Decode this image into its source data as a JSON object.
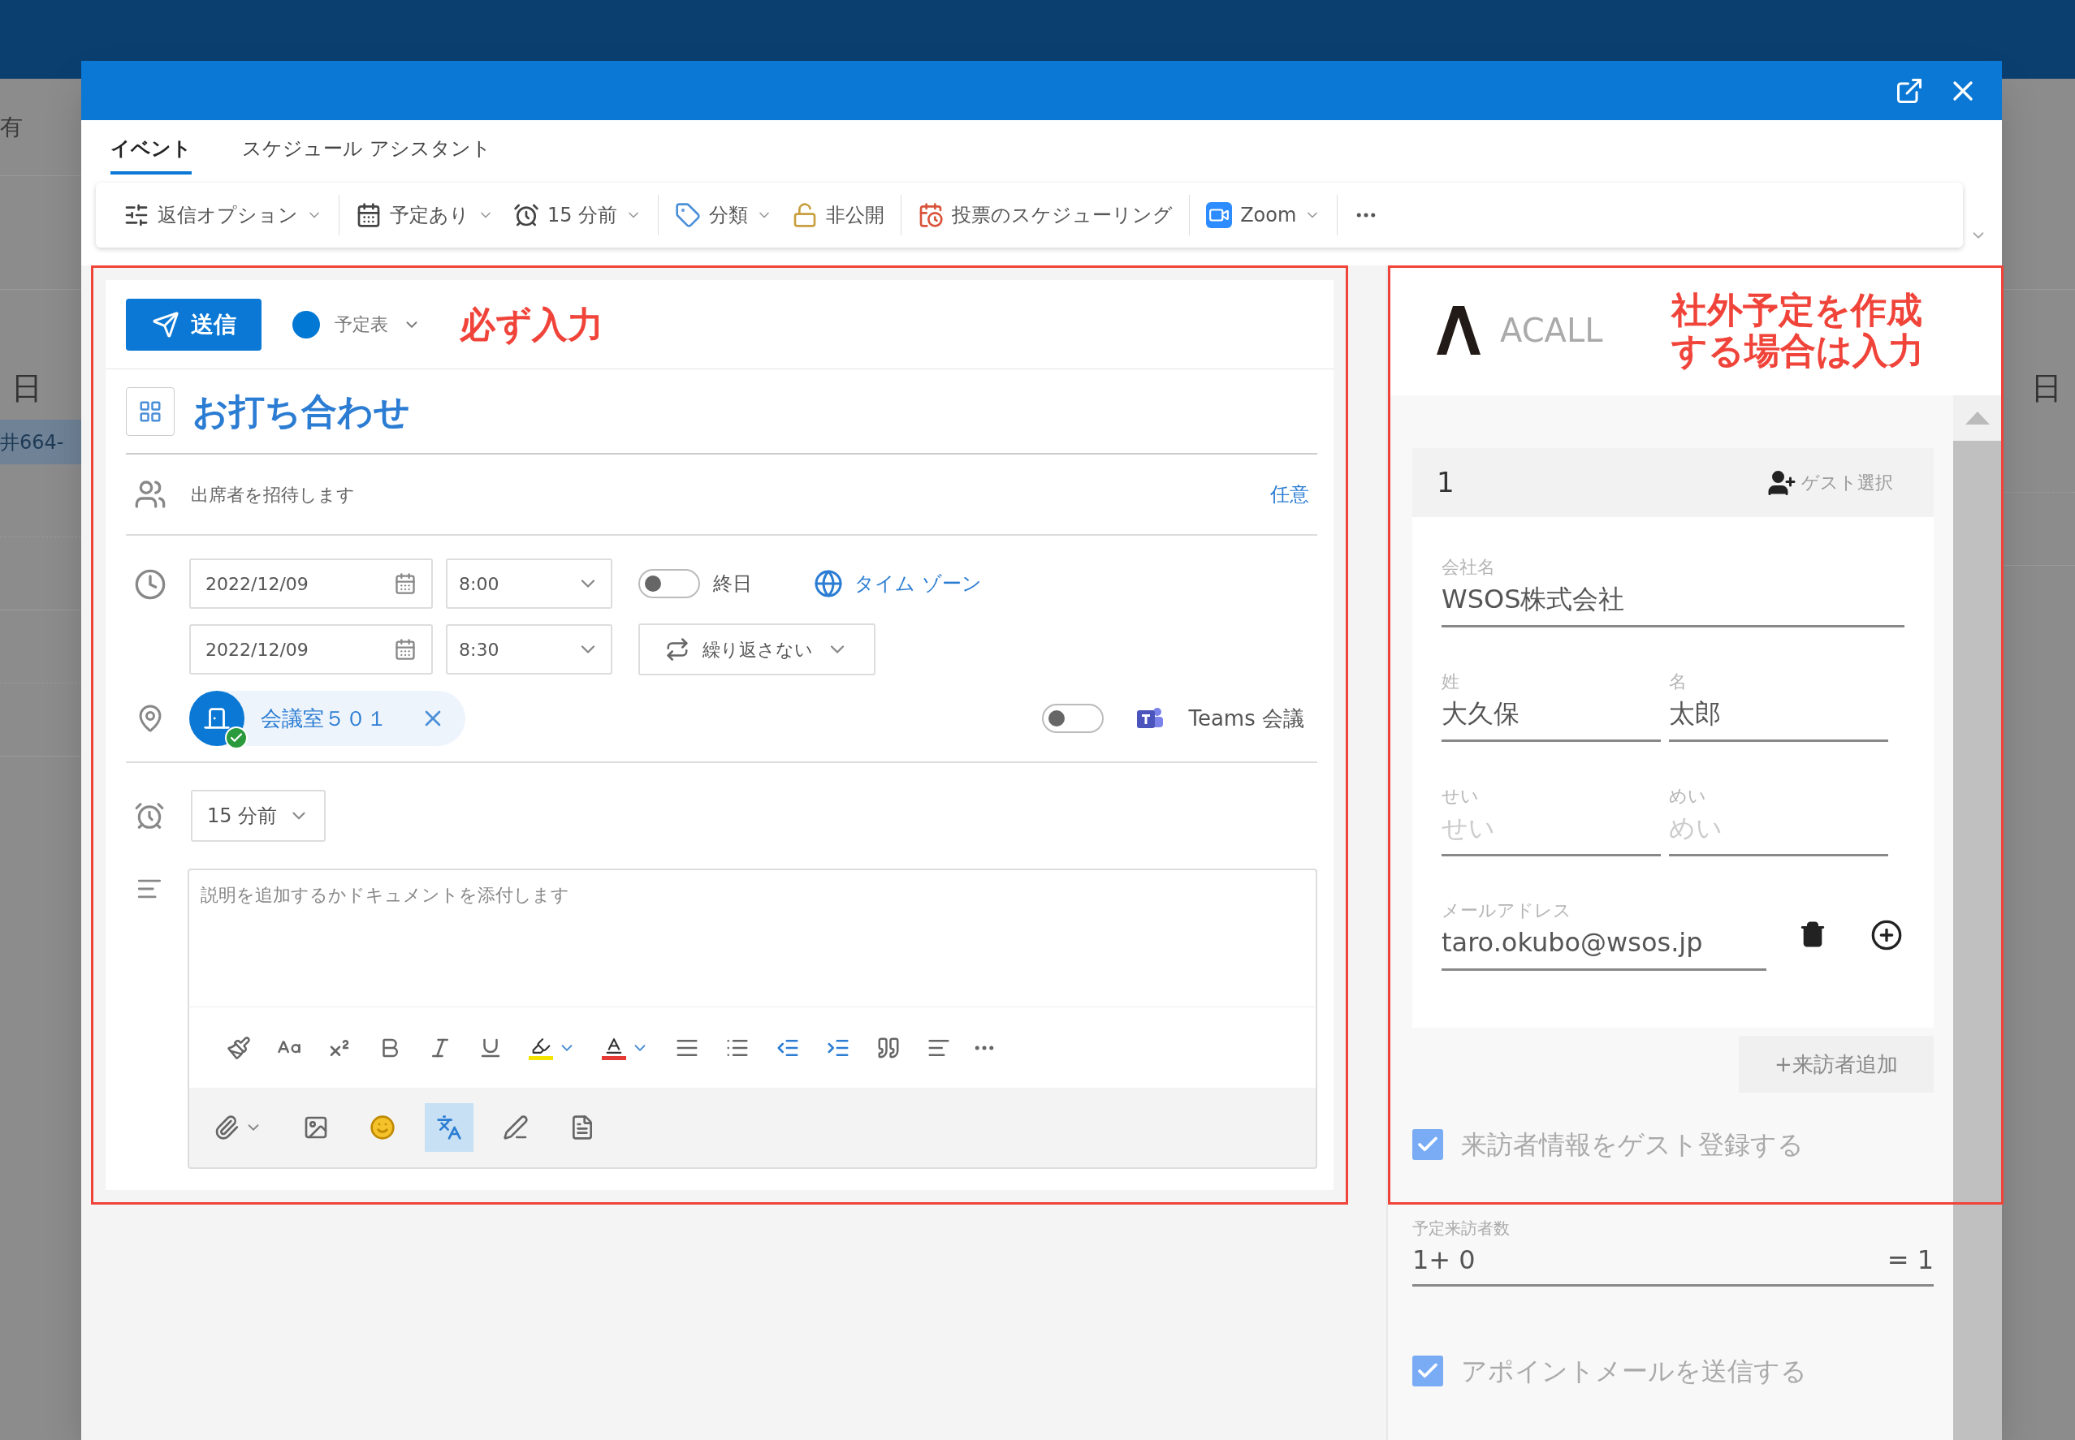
{
  "background": {
    "left_texts": [
      "有",
      "日",
      "井664-"
    ],
    "right_text": "日"
  },
  "tabs": [
    {
      "label": "イベント",
      "selected": true
    },
    {
      "label": "スケジュール アシスタント",
      "selected": false
    }
  ],
  "toolbar": [
    [
      {
        "label": "返信オプション",
        "dropdown": true
      }
    ],
    [
      {
        "label": "予定あり",
        "dropdown": true
      },
      {
        "label": "15 分前",
        "dropdown": true
      }
    ],
    [
      {
        "label": "分類",
        "dropdown": true
      },
      {
        "label": "非公開",
        "dropdown": false
      }
    ],
    [
      {
        "label": "投票のスケジューリング",
        "dropdown": false
      }
    ],
    [
      {
        "label": "Zoom",
        "dropdown": true
      }
    ]
  ],
  "event": {
    "send_button": "送信",
    "calendar": {
      "label": "予定表",
      "color": "#0078d4"
    },
    "annotation": "必ず入力",
    "title": "お打ち合わせ",
    "attendees": {
      "placeholder": "出席者を招待します",
      "optional": "任意"
    },
    "start": {
      "date": "2022/12/09",
      "time": "8:00"
    },
    "all_day": {
      "label": "終日",
      "on": false
    },
    "timezone": "タイム ゾーン",
    "end": {
      "date": "2022/12/09",
      "time": "8:30"
    },
    "repeat": "繰り返さない",
    "room": {
      "name": "会議室５０１",
      "available": true
    },
    "teams": {
      "label": "Teams 会議",
      "on": false
    },
    "reminder": "15 分前",
    "description": {
      "placeholder": "説明を追加するかドキュメントを添付します"
    },
    "format_tools": [
      {
        "active": false
      },
      {
        "active": false
      },
      {
        "active": false
      },
      {
        "active": false
      },
      {
        "active": false
      },
      {
        "active": false
      },
      {
        "active": false
      },
      {
        "active": false
      },
      {
        "active": false
      },
      {
        "active": false
      },
      {
        "active": false
      },
      {
        "active": false
      },
      {
        "active": false
      },
      {
        "active": false
      }
    ],
    "insert_tools": [
      {
        "active": false
      },
      {
        "active": false
      },
      {
        "active": false
      },
      {
        "active": true
      },
      {
        "active": false
      },
      {
        "active": false
      }
    ]
  },
  "visitor_panel": {
    "logo": "ACALL",
    "annotation_lines": [
      "社外予定を作成",
      "する場合は入力"
    ],
    "visitor": {
      "number": "1",
      "guest_select": "ゲスト選択",
      "company": {
        "label": "会社名",
        "value": "WSOS株式会社"
      },
      "last_name": {
        "label": "姓",
        "value": "大久保"
      },
      "first_name": {
        "label": "名",
        "value": "太郎"
      },
      "last_kana": {
        "label": "せい",
        "placeholder": "せい"
      },
      "first_kana": {
        "label": "めい",
        "placeholder": "めい"
      },
      "email": {
        "label": "メールアドレス",
        "value": "taro.okubo@wsos.jp"
      }
    },
    "add_visitor": "+来訪者追加",
    "register_guest": {
      "label": "来訪者情報をゲスト登録する",
      "checked": true
    },
    "total": {
      "label": "予定来訪者数",
      "value": "1+ 0",
      "result": "= 1"
    },
    "send_mail": {
      "label": "アポイントメールを送信する",
      "checked": true
    }
  }
}
